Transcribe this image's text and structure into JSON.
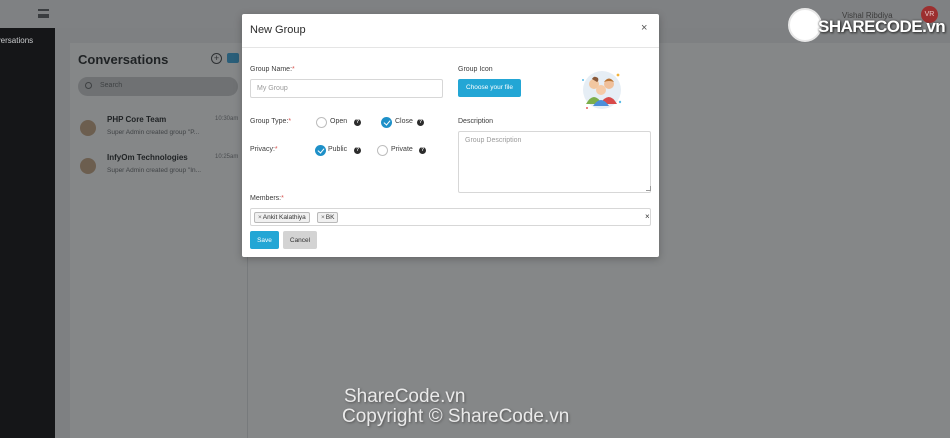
{
  "app": {
    "user_name": "Vishal Ribdiya",
    "user_initials": "VR",
    "sidebar_item": "Conversations"
  },
  "conversations": {
    "title": "Conversations",
    "search_placeholder": "Search",
    "items": [
      {
        "name": "PHP Core Team",
        "time": "10:30am",
        "preview": "Super Admin created group \"P..."
      },
      {
        "name": "InfyOm Technologies",
        "time": "10:25am",
        "preview": "Super Admin created group \"In..."
      }
    ]
  },
  "modal": {
    "title": "New Group",
    "close": "×",
    "group_name_label": "Group Name:",
    "group_name_placeholder": "My Group",
    "group_icon_label": "Group Icon",
    "choose_file_label": "Choose your file",
    "group_type_label": "Group Type:",
    "group_type_options": [
      {
        "label": "Open",
        "checked": false
      },
      {
        "label": "Close",
        "checked": true
      }
    ],
    "privacy_label": "Privacy:",
    "privacy_options": [
      {
        "label": "Public",
        "checked": true
      },
      {
        "label": "Private",
        "checked": false
      }
    ],
    "description_label": "Description",
    "description_placeholder": "Group Description",
    "members_label": "Members:",
    "members": [
      "Ankit Kalathiya",
      "BK"
    ],
    "members_clear": "×",
    "save_label": "Save",
    "cancel_label": "Cancel",
    "required_mark": "*",
    "help_mark": "?"
  },
  "watermark": {
    "logo_text": "SHARECODE.vn",
    "line1": "ShareCode.vn",
    "line2": "Copyright © ShareCode.vn"
  },
  "colors": {
    "accent": "#23a6d5",
    "radio_checked": "#1e90c8",
    "required": "#d9534f"
  }
}
